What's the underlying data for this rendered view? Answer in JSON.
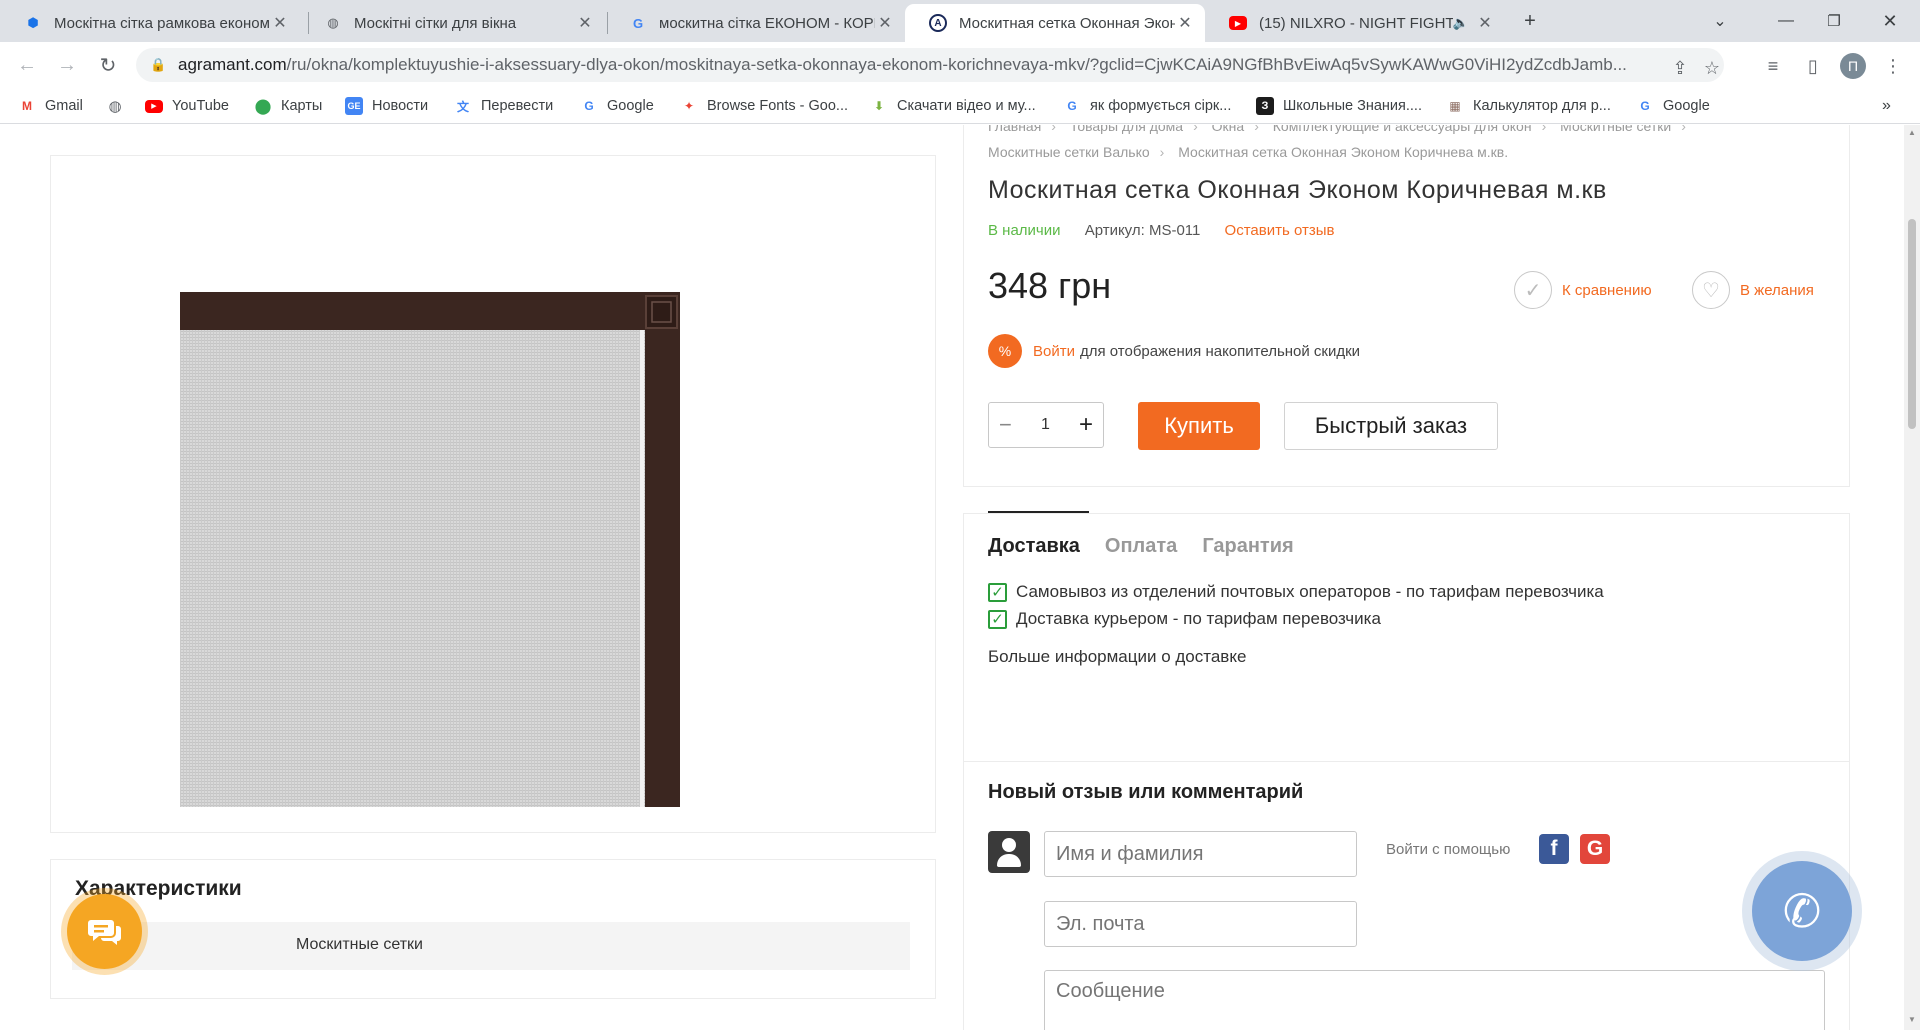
{
  "browser": {
    "tabs": [
      {
        "title": "Москітна сітка рамкова економ",
        "active": false
      },
      {
        "title": "Москітні сітки для вікна",
        "active": false
      },
      {
        "title": "москитна сітка ЕКОНОМ - КОРИ",
        "active": false
      },
      {
        "title": "Москитная сетка Оконная Экон",
        "active": true
      },
      {
        "title": "(15) NILXRO - NIGHT FIGHT |",
        "active": false
      }
    ],
    "new_tab": "+",
    "url_domain": "agramant.com",
    "url_path": "/ru/okna/komplektuyushie-i-aksessuary-dlya-okon/moskitnaya-setka-okonnaya-ekonom-korichnevaya-mkv/?gclid=CjwKCAiA9NGfBhBvEiwAq5vSywKAWwG0ViHI2ydZcdbJamb...",
    "profile_initial": "П",
    "bookmarks": [
      {
        "label": "Gmail",
        "icon": "gmail-icon"
      },
      {
        "label": "",
        "icon": "globe-icon"
      },
      {
        "label": "YouTube",
        "icon": "youtube-icon"
      },
      {
        "label": "Карты",
        "icon": "maps-pin-icon"
      },
      {
        "label": "Новости",
        "icon": "news-icon"
      },
      {
        "label": "Перевести",
        "icon": "translate-icon"
      },
      {
        "label": "Google",
        "icon": "google-icon"
      },
      {
        "label": "Browse Fonts - Goo...",
        "icon": "fonts-icon"
      },
      {
        "label": "Скачати відео и му...",
        "icon": "download-icon"
      },
      {
        "label": "як формується сірк...",
        "icon": "google-icon"
      },
      {
        "label": "Школьные Знания....",
        "icon": "znania-icon"
      },
      {
        "label": "Калькулятор для р...",
        "icon": "calculator-icon"
      },
      {
        "label": "Google",
        "icon": "google-icon"
      }
    ],
    "more_bookmarks": "»"
  },
  "breadcrumb": {
    "line1": [
      "Главная",
      "Товары для дома",
      "Окна",
      "Комплектующие и аксессуары для окон",
      "Москитные сетки"
    ],
    "line2": [
      "Москитные сетки Валько",
      "Москитная сетка Оконная Эконом Коричнева м.кв."
    ]
  },
  "product": {
    "title": "Москитная сетка Оконная Эконом Коричневая м.кв",
    "stock": "В наличии",
    "sku": "Артикул: MS-011",
    "review_link": "Оставить отзыв",
    "price": "348 грн",
    "compare": "К сравнению",
    "wishlist": "В желания",
    "discount_badge": "%",
    "discount_login": "Войти",
    "discount_text": "для отображения накопительной скидки",
    "quantity": "1",
    "minus": "−",
    "plus": "+",
    "buy": "Купить",
    "quick_order": "Быстрый заказ"
  },
  "delivery": {
    "tabs": [
      "Доставка",
      "Оплата",
      "Гарантия"
    ],
    "items": [
      "Самовывоз из отделений почтовых операторов - по тарифам перевозчика",
      "Доставка курьером - по тарифам перевозчика"
    ],
    "more": "Больше информации о доставке"
  },
  "review_form": {
    "title": "Новый отзыв или комментарий",
    "name_placeholder": "Имя и фамилия",
    "email_placeholder": "Эл. почта",
    "message_placeholder": "Сообщение",
    "login_with": "Войти с помощью",
    "facebook": "f",
    "google": "G"
  },
  "characteristics": {
    "title": "Характеристики",
    "value": "Москитные сетки"
  },
  "colors": {
    "accent": "#f26a21",
    "in_stock": "#5bb947",
    "frame_brown": "#3b2620",
    "chat": "#f5a623",
    "call": "#7da4d8"
  }
}
